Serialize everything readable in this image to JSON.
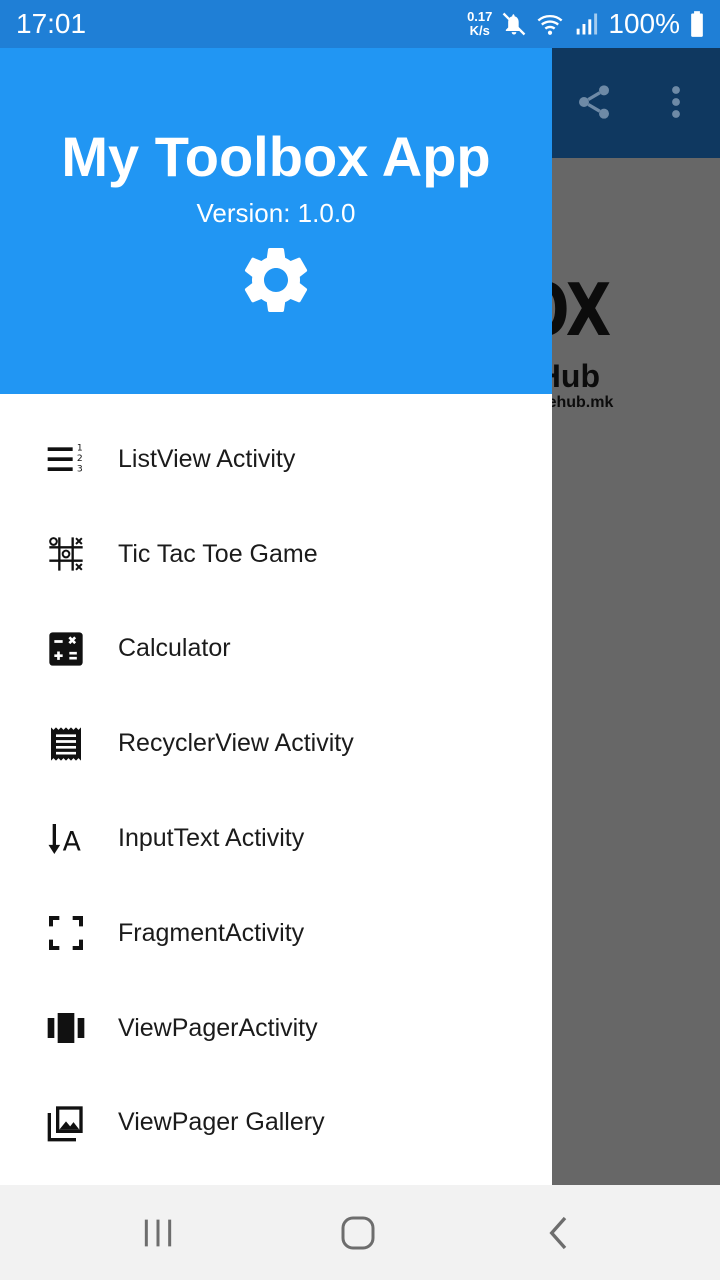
{
  "status_bar": {
    "time": "17:01",
    "net_speed_value": "0.17",
    "net_speed_unit": "K/s",
    "battery": "100%"
  },
  "background": {
    "logo_word": "BOX",
    "logo_hub": "eHub",
    "logo_url": "ativehub.mk"
  },
  "drawer": {
    "title": "My Toolbox App",
    "version": "Version: 1.0.0",
    "items": [
      {
        "label": "ListView Activity",
        "icon": "format-list-numbered-icon"
      },
      {
        "label": "Tic Tac Toe Game",
        "icon": "tic-tac-toe-icon"
      },
      {
        "label": "Calculator",
        "icon": "calculator-icon"
      },
      {
        "label": "RecyclerView Activity",
        "icon": "receipt-list-icon"
      },
      {
        "label": "InputText Activity",
        "icon": "text-input-icon"
      },
      {
        "label": "FragmentActivity",
        "icon": "crop-free-icon"
      },
      {
        "label": "ViewPagerActivity",
        "icon": "view-carousel-icon"
      },
      {
        "label": "ViewPager Gallery",
        "icon": "photo-library-icon"
      }
    ]
  },
  "colors": {
    "status_bar": "#1f7fd6",
    "drawer_header": "#2196f3",
    "toolbar": "#0f3860",
    "scrim": "#676767"
  }
}
